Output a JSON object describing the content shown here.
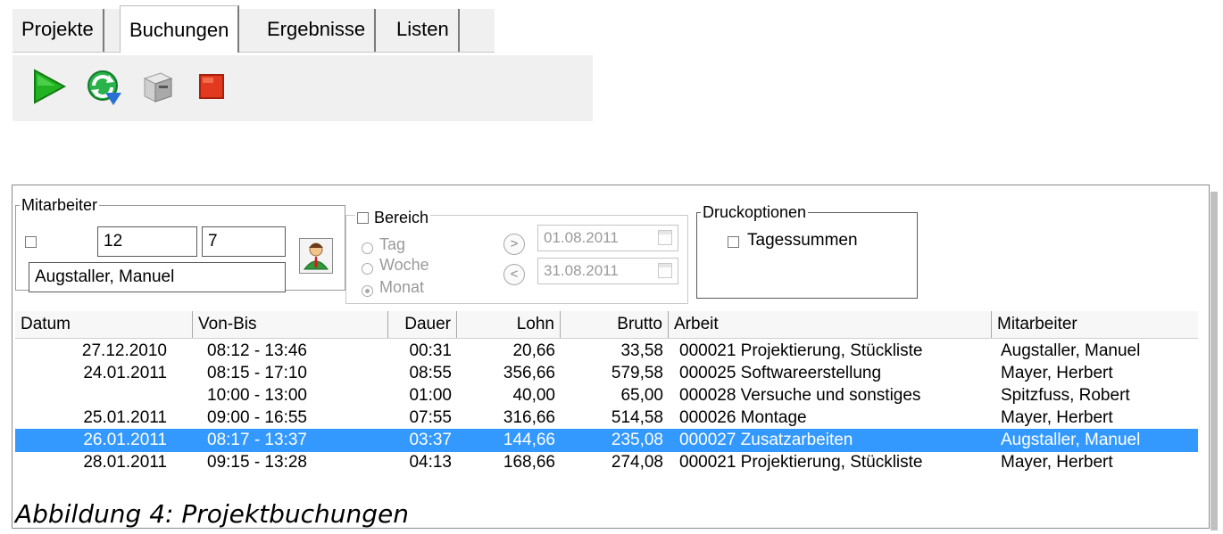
{
  "tabs": [
    "Projekte",
    "Buchungen",
    "Ergebnisse",
    "Listen"
  ],
  "toolbar": {
    "icons": [
      "play-icon",
      "refresh-icon",
      "printer-icon",
      "stop-icon"
    ]
  },
  "mitarbeiter": {
    "legend": "Mitarbeiter",
    "field1": "12",
    "field2": "7",
    "name": "Augstaller, Manuel"
  },
  "bereich": {
    "legend": "Bereich",
    "options": [
      "Tag",
      "Woche",
      "Monat"
    ],
    "selected": "Monat",
    "date_from": "01.08.2011",
    "date_to": "31.08.2011",
    "next_label": ">",
    "prev_label": "<"
  },
  "druck": {
    "legend": "Druckoptionen",
    "option": "Tagessummen"
  },
  "table": {
    "headers": [
      "Datum",
      "Von-Bis",
      "Dauer",
      "Lohn",
      "Brutto",
      "Arbeit",
      "Mitarbeiter"
    ],
    "rows": [
      [
        "27.12.2010",
        "08:12 - 13:46",
        "00:31",
        "20,66",
        "33,58",
        "000021 Projektierung, Stückliste",
        "Augstaller, Manuel"
      ],
      [
        "24.01.2011",
        "08:15 - 17:10",
        "08:55",
        "356,66",
        "579,58",
        "000025 Softwareerstellung",
        "Mayer, Herbert"
      ],
      [
        "",
        "10:00 - 13:00",
        "01:00",
        "40,00",
        "65,00",
        "000028 Versuche und sonstiges",
        "Spitzfuss, Robert"
      ],
      [
        "25.01.2011",
        "09:00 - 16:55",
        "07:55",
        "316,66",
        "514,58",
        "000026 Montage",
        "Mayer, Herbert"
      ],
      [
        "26.01.2011",
        "08:17 - 13:37",
        "03:37",
        "144,66",
        "235,08",
        "000027 Zusatzarbeiten",
        "Augstaller, Manuel"
      ],
      [
        "28.01.2011",
        "09:15 - 13:28",
        "04:13",
        "168,66",
        "274,08",
        "000021 Projektierung, Stückliste",
        "Mayer, Herbert"
      ]
    ],
    "selected_row": 4,
    "selection_color": "#3399ff"
  },
  "caption": "Abbildung 4: Projektbuchungen"
}
